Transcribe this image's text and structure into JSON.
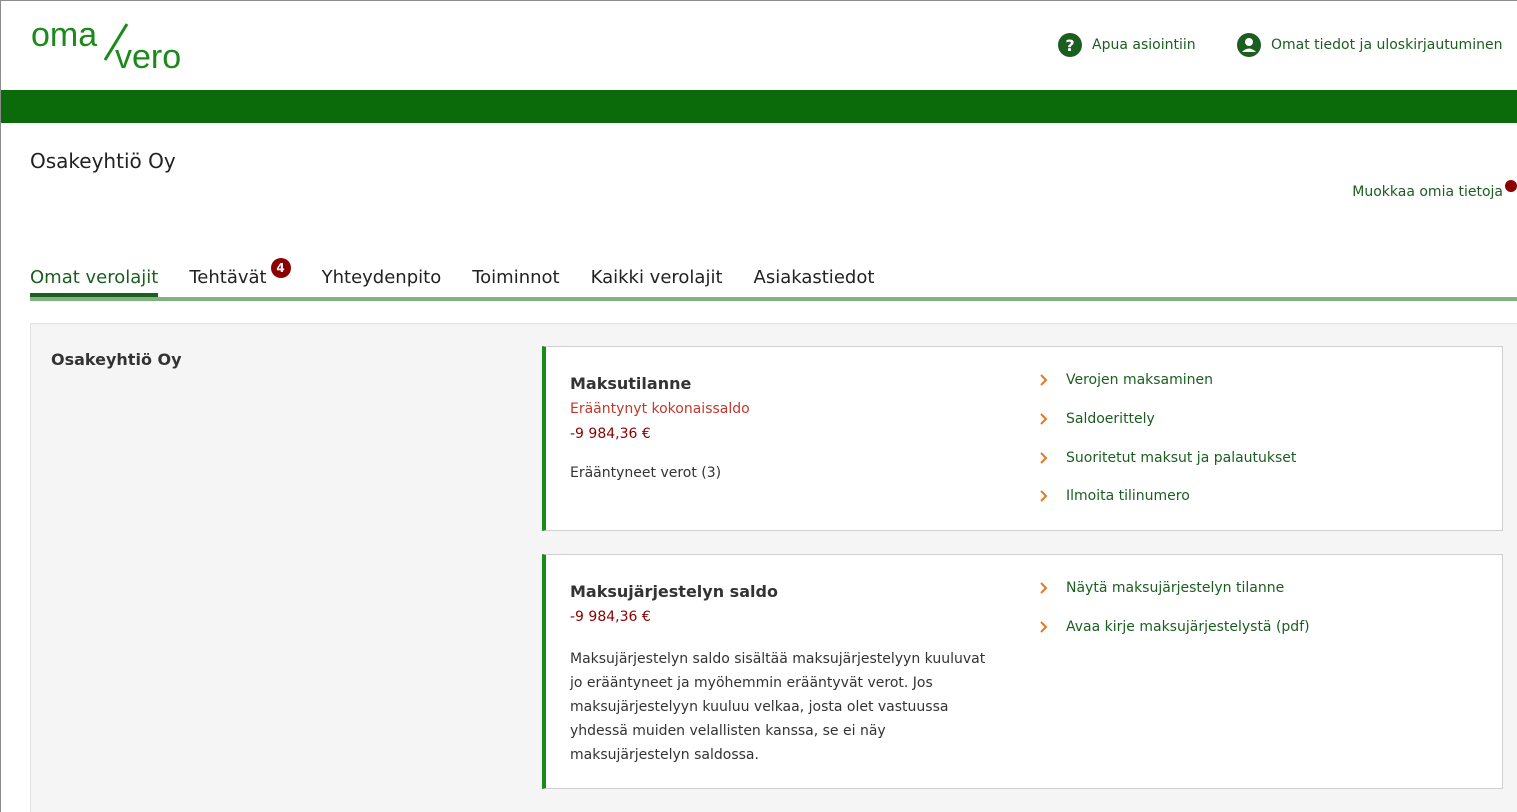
{
  "header": {
    "logo_text_1": "oma",
    "logo_text_2": "vero",
    "help_label": "Apua asiointiin",
    "user_label": "Omat tiedot ja uloskirjautuminen"
  },
  "page": {
    "company_name": "Osakeyhtiö Oy",
    "edit_link": "Muokkaa omia tietoja"
  },
  "tabs": [
    {
      "label": "Omat verolajit",
      "active": true
    },
    {
      "label": "Tehtävät",
      "badge": "4"
    },
    {
      "label": "Yhteydenpito"
    },
    {
      "label": "Toiminnot"
    },
    {
      "label": "Kaikki verolajit"
    },
    {
      "label": "Asiakastiedot"
    }
  ],
  "panel": {
    "company_name": "Osakeyhtiö Oy"
  },
  "card1": {
    "title": "Maksutilanne",
    "overdue_label": "Erääntynyt kokonaissaldo",
    "amount": "-9 984,36 €",
    "overdue_taxes": "Erääntyneet verot (3)",
    "links": [
      "Verojen maksaminen",
      "Saldoerittely",
      "Suoritetut maksut ja palautukset",
      "Ilmoita tilinumero"
    ]
  },
  "card2": {
    "title": "Maksujärjestelyn saldo",
    "amount": "-9 984,36 €",
    "description_lines": [
      "Maksujärjestelyn saldo sisältää maksujärjestelyyn kuuluvat",
      "jo erääntyneet ja myöhemmin erääntyvät verot. Jos",
      "maksujärjestelyyn kuuluu velkaa, josta olet vastuussa",
      "yhdessä muiden velallisten kanssa, se ei näy",
      "maksujärjestelyn saldossa."
    ],
    "links": [
      "Näytä maksujärjestelyn tilanne",
      "Avaa kirje maksujärjestelystä (pdf)"
    ]
  },
  "colors": {
    "brand_green": "#1b5e20",
    "bar_green": "#0b6b0b",
    "accent_orange": "#e87722",
    "badge_red": "#8b0000"
  }
}
